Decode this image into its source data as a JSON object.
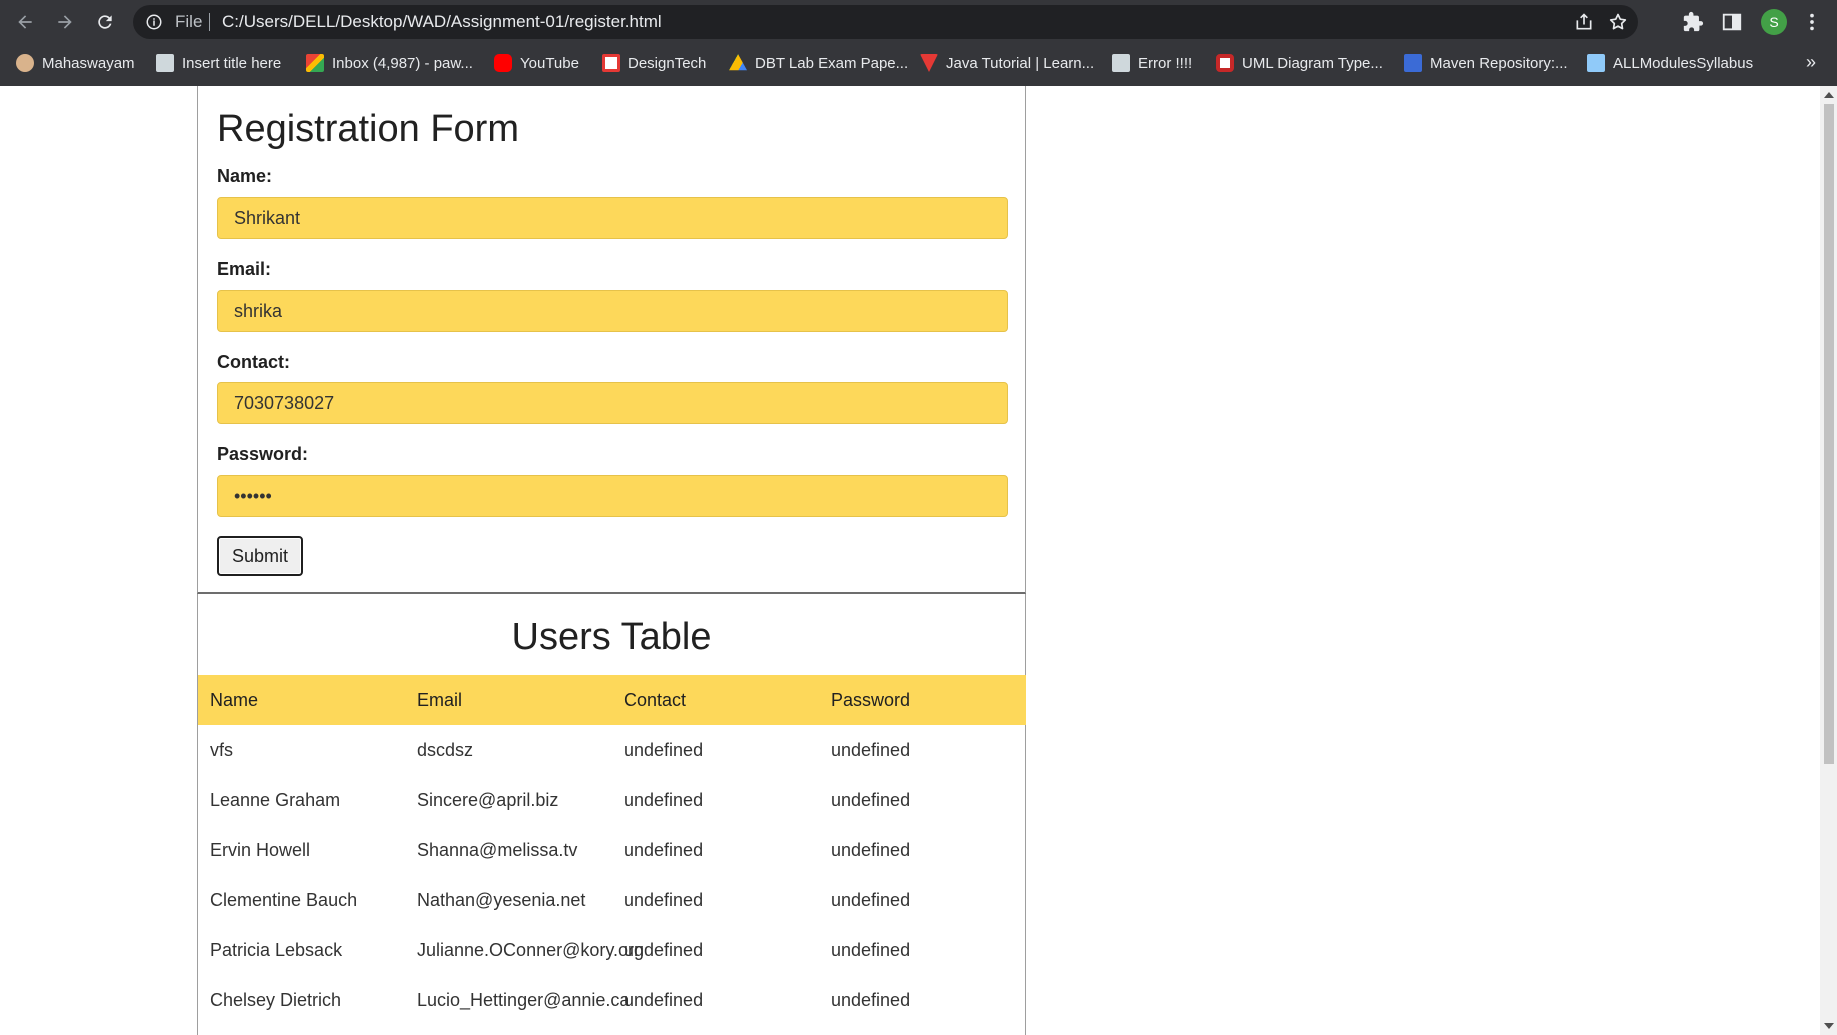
{
  "browser": {
    "url_scheme": "File",
    "url": "C:/Users/DELL/Desktop/WAD/Assignment-01/register.html",
    "profile_initial": "S",
    "bookmarks": [
      {
        "label": "Mahaswayam",
        "icon": "mahaswayam-icon",
        "color": "#d9b38c"
      },
      {
        "label": "Insert title here",
        "icon": "page-icon",
        "color": "#cfd8dc"
      },
      {
        "label": "Inbox (4,987) - paw...",
        "icon": "gmail-icon",
        "color": "#ea4335"
      },
      {
        "label": "YouTube",
        "icon": "youtube-icon",
        "color": "#ff0000"
      },
      {
        "label": "DesignTech",
        "icon": "designtech-icon",
        "color": "#e53935"
      },
      {
        "label": "DBT Lab Exam Pape...",
        "icon": "drive-icon",
        "color": "#fbbc04"
      },
      {
        "label": "Java Tutorial | Learn...",
        "icon": "javatpoint-icon",
        "color": "#e53935"
      },
      {
        "label": "Error !!!!",
        "icon": "page-icon",
        "color": "#cfd8dc"
      },
      {
        "label": "UML Diagram Type...",
        "icon": "uml-icon",
        "color": "#ffffff"
      },
      {
        "label": "Maven Repository:...",
        "icon": "maven-icon",
        "color": "#3b6bd6"
      },
      {
        "label": "ALLModulesSyllabus",
        "icon": "syllabus-icon",
        "color": "#90caf9"
      }
    ],
    "more_bookmarks": "»"
  },
  "form": {
    "title": "Registration Form",
    "name_label": "Name:",
    "name_value": "Shrikant",
    "email_label": "Email:",
    "email_value": "shrika",
    "contact_label": "Contact:",
    "contact_value": "7030738027",
    "password_label": "Password:",
    "password_value": "••••••",
    "submit_label": "Submit"
  },
  "table": {
    "title": "Users Table",
    "columns": [
      "Name",
      "Email",
      "Contact",
      "Password"
    ],
    "rows": [
      [
        "vfs",
        "dscdsz",
        "undefined",
        "undefined"
      ],
      [
        "Leanne Graham",
        "Sincere@april.biz",
        "undefined",
        "undefined"
      ],
      [
        "Ervin Howell",
        "Shanna@melissa.tv",
        "undefined",
        "undefined"
      ],
      [
        "Clementine Bauch",
        "Nathan@yesenia.net",
        "undefined",
        "undefined"
      ],
      [
        "Patricia Lebsack",
        "Julianne.OConner@kory.org",
        "undefined",
        "undefined"
      ],
      [
        "Chelsey Dietrich",
        "Lucio_Hettinger@annie.ca",
        "undefined",
        "undefined"
      ]
    ]
  },
  "colors": {
    "accent_yellow": "#fdd85a",
    "chrome_dark": "#35363a"
  }
}
